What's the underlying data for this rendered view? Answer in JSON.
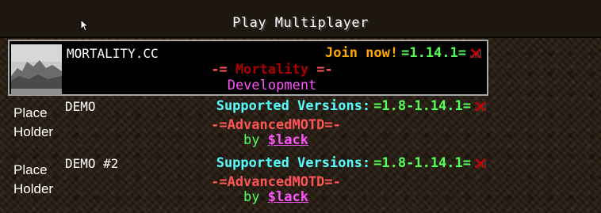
{
  "screen": {
    "title": "Play Multiplayer"
  },
  "servers": [
    {
      "name": "MORTALITY.CC",
      "status_main": "Join now!",
      "status_version": "=1.14.1=",
      "motd_line1": {
        "prefix": "-= ",
        "name": "Mortality",
        "suffix": " =-"
      },
      "motd_line2": "Development",
      "icon": "server-thumbnail-image",
      "signal_icon": "no-connection-icon",
      "colors": {
        "status": "#ffaa00",
        "version": "#55ff55",
        "motd_brackets": "#ff5555",
        "motd_name": "#aa0000",
        "motd_line2": "#ff55ff"
      }
    },
    {
      "name": "DEMO",
      "placeholder_icon_text_1": "Place",
      "placeholder_icon_text_2": "Holder",
      "status_main": "Supported Versions:",
      "status_version": "=1.8-1.14.1=",
      "motd_line1": {
        "prefix": "-=",
        "name": "AdvancedMOTD",
        "suffix": "=-"
      },
      "motd_line2": {
        "by": "by ",
        "author": "$lack"
      },
      "signal_icon": "no-connection-icon",
      "colors": {
        "status": "#55ffff",
        "version": "#55ff55",
        "motd_line1": "#ff5555",
        "by": "#55ff55",
        "author": "#ff55ff"
      }
    },
    {
      "name": "DEMO #2",
      "placeholder_icon_text_1": "Place",
      "placeholder_icon_text_2": "Holder",
      "status_main": "Supported Versions:",
      "status_version": "=1.8-1.14.1=",
      "motd_line1": {
        "prefix": "-=",
        "name": "AdvancedMOTD",
        "suffix": "=-"
      },
      "motd_line2": {
        "by": "by ",
        "author": "$lack"
      },
      "signal_icon": "no-connection-icon",
      "colors": {
        "status": "#55ffff",
        "version": "#55ff55",
        "motd_line1": "#ff5555",
        "by": "#55ff55",
        "author": "#ff55ff"
      }
    }
  ]
}
